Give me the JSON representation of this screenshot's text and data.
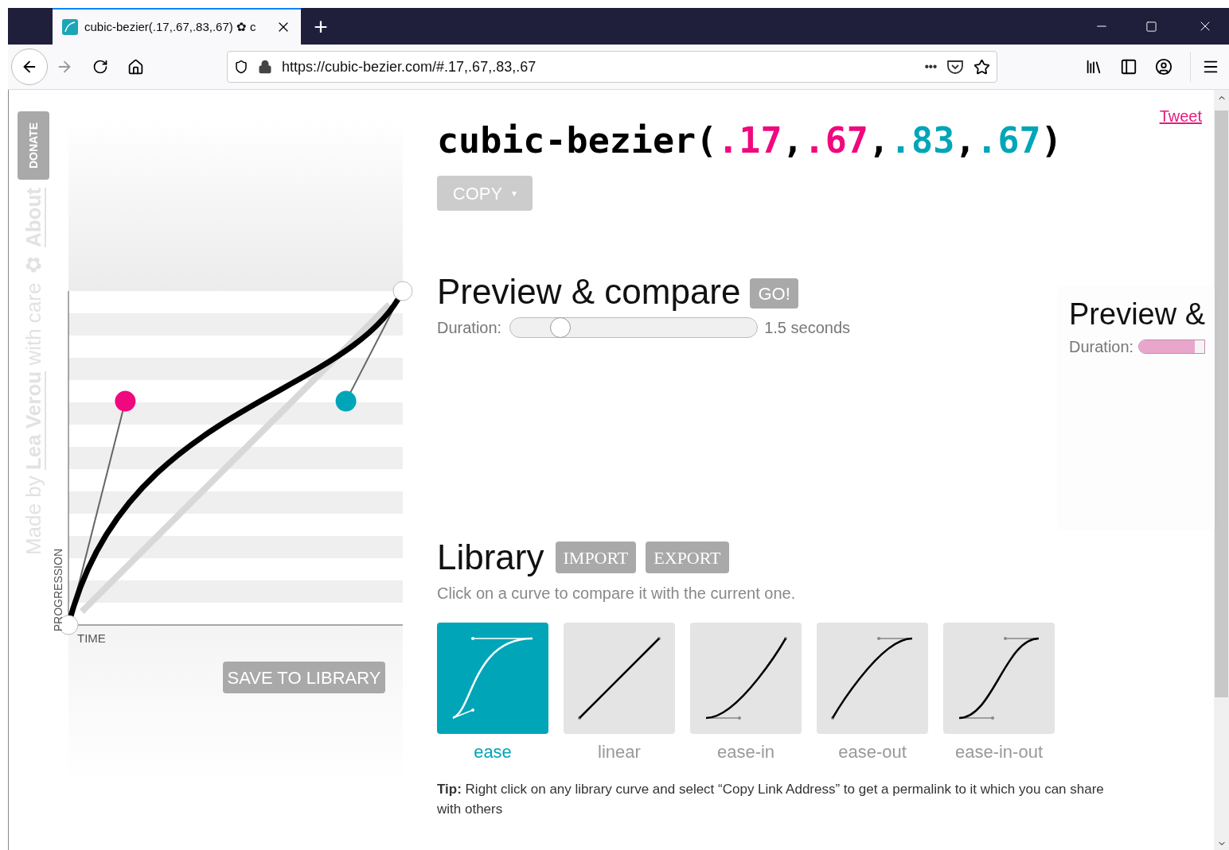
{
  "browser": {
    "tab": {
      "title": "cubic-bezier(.17,.67,.83,.67) ✿ c",
      "selected": true
    },
    "new_tab": "+",
    "url": "https://cubic-bezier.com/#.17,.67,.83,.67",
    "more": "•••"
  },
  "sidebar": {
    "donate": "DONATE",
    "credit": {
      "before": "Made by ",
      "author": "Lea Verou",
      "middle": " with care ",
      "flower": "✿",
      "about": "About"
    }
  },
  "curve_editor": {
    "y_axis": "PROGRESSION",
    "x_axis": "TIME",
    "save_button": "SAVE TO LIBRARY"
  },
  "title": {
    "prefix": "cubic-bezier(",
    "separator": ",",
    "suffix": ")",
    "values": [
      {
        "text": ".17",
        "color": "#f0087e"
      },
      {
        "text": ".67",
        "color": "#f0087e"
      },
      {
        "text": ".83",
        "color": "#00a5b8"
      },
      {
        "text": ".67",
        "color": "#00a5b8"
      }
    ]
  },
  "copy_button": {
    "label": "COPY",
    "caret": "▾"
  },
  "tweet": "Tweet",
  "preview": {
    "heading": "Preview & compare",
    "go": "GO!",
    "duration_label": "Duration:",
    "level": 0.16,
    "reading": "1.5 seconds"
  },
  "preview_pane": {
    "heading": "Preview &",
    "duration_label": "Duration:",
    "level": 0.85
  },
  "library": {
    "heading": "Library",
    "buttons": [
      "IMPORT",
      "EXPORT"
    ],
    "hint": "Click on a curve to compare it with the current one.",
    "curves": [
      {
        "label": "ease",
        "kind": "ease",
        "selected": true
      },
      {
        "label": "linear",
        "kind": "linear",
        "selected": false
      },
      {
        "label": "ease-in",
        "kind": "ease-in",
        "selected": false
      },
      {
        "label": "ease-out",
        "kind": "ease-out",
        "selected": false
      },
      {
        "label": "ease-in-out",
        "kind": "ease-in-out",
        "selected": false
      }
    ],
    "tip": "**Tip:** Right click on any library curve and select “Copy Link Address” to get a permalink to it which you can share with others"
  }
}
